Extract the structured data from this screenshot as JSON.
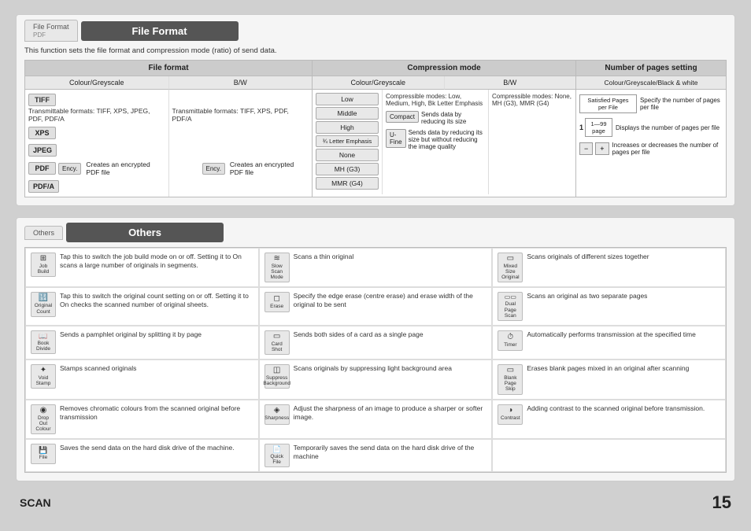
{
  "page": {
    "background_color": "#d0d0d0"
  },
  "file_format_section": {
    "tab_label": "File Format",
    "tab_sub_label": "PDF",
    "header_title": "File Format",
    "description": "This function sets the file format and compression mode (ratio) of send data.",
    "file_format": {
      "section_title": "File format",
      "col_colour_greyscale": "Colour/Greyscale",
      "col_bw": "B/W",
      "formats": [
        {
          "label": "TIFF",
          "desc_colour": "Transmittable formats: TIFF, XPS, JPEG, PDF, PDF/A",
          "desc_bw": "Transmittable formats: TIFF, XPS, PDF, PDF/A"
        },
        {
          "label": "XPS",
          "desc_colour": "",
          "desc_bw": ""
        },
        {
          "label": "JPEG",
          "desc_colour": "",
          "desc_bw": ""
        },
        {
          "label": "PDF",
          "ency_colour": "Ency.",
          "ency_bw": "Ency.",
          "desc_colour": "Creates an encrypted PDF file",
          "desc_bw": "Creates an encrypted PDF file"
        },
        {
          "label": "PDF/A",
          "desc_colour": "",
          "desc_bw": ""
        }
      ]
    },
    "compression_mode": {
      "section_title": "Compression mode",
      "col_colour_greyscale": "Colour/Greyscale",
      "col_bw": "B/W",
      "levels": [
        "Low",
        "Middle",
        "High",
        "¾ Letter Emphasis",
        "None",
        "MH (G3)",
        "MMR (G4)"
      ],
      "compressible_desc": "Compressible modes: Low, Medium, High, Bk Letter Emphasis",
      "compact_label": "Compact",
      "compact_desc": "Sends data by reducing its size",
      "ufine_label": "U-Fine",
      "ufine_desc": "Sends data by reducing its size but without reducing the image quality",
      "bw_modes_label": "Compressible modes: None, MH (G3), MMR (G4)"
    },
    "pages_setting": {
      "section_title": "Number of pages setting",
      "col_label": "Colour/Greyscale/Black & white",
      "specified_pages_label": "Satisfied Pages per File",
      "specify_desc": "Specify the number of pages per file",
      "current_page_num": "1",
      "page_range": "1—99",
      "page_label": "page",
      "displays_desc": "Displays the number of pages per file",
      "increases_desc": "Increases or decreases the number of pages per file"
    }
  },
  "others_section": {
    "tab_label": "Others",
    "header_title": "Others",
    "items": [
      {
        "icon_label": "Job Build",
        "icon_glyph": "⊞",
        "text": "Tap this to switch the job build mode on or off. Setting it to On scans a large number of originals in segments."
      },
      {
        "icon_label": "Slow Scan Mode",
        "icon_glyph": "≋",
        "text": "Scans a thin original"
      },
      {
        "icon_label": "Mixed Size Original",
        "icon_glyph": "▭",
        "text": "Scans originals of different sizes together"
      },
      {
        "icon_label": "Original Count",
        "icon_glyph": "⊞",
        "text": "Tap this to switch the original count setting on or off. Setting it to On checks the scanned number of original sheets."
      },
      {
        "icon_label": "Erase",
        "icon_glyph": "◻",
        "text": "Specify the edge erase (centre erase) and erase width of the original to be sent"
      },
      {
        "icon_label": "Dual Page Scan",
        "icon_glyph": "▭▭",
        "text": "Scans an original as two separate pages"
      },
      {
        "icon_label": "Book Divide",
        "icon_glyph": "📖",
        "text": "Sends a pamphlet original by splitting it by page"
      },
      {
        "icon_label": "Card Shot",
        "icon_glyph": "▭",
        "text": "Sends both sides of a card as a single page"
      },
      {
        "icon_label": "Timer",
        "icon_glyph": "⏱",
        "text": "Automatically performs transmission at the specified time"
      },
      {
        "icon_label": "Void Stamp",
        "icon_glyph": "✦",
        "text": "Stamps scanned originals"
      },
      {
        "icon_label": "Suppress Background",
        "icon_glyph": "◫",
        "text": "Scans originals by suppressing light background area"
      },
      {
        "icon_label": "Blank Page Skip",
        "icon_glyph": "▭",
        "text": "Erases blank pages mixed in an original after scanning"
      },
      {
        "icon_label": "Drop Out Colour",
        "icon_glyph": "◉",
        "text": "Removes chromatic colours from the scanned original before transmission"
      },
      {
        "icon_label": "Sharpness",
        "icon_glyph": "◈",
        "text": "Adjust the sharpness of an image to produce a sharper or softer image."
      },
      {
        "icon_label": "Contrast",
        "icon_glyph": "◑",
        "text": "Adding contrast to the scanned original before transmission."
      },
      {
        "icon_label": "File",
        "icon_glyph": "💾",
        "text": "Saves the send data on the hard disk drive of the machine."
      },
      {
        "icon_label": "Quick File",
        "icon_glyph": "📄",
        "text": "Temporarily saves the send data on the hard disk drive of the machine"
      },
      {
        "icon_label": "",
        "icon_glyph": "",
        "text": ""
      }
    ]
  },
  "footer": {
    "scan_label": "SCAN",
    "page_number": "15"
  }
}
